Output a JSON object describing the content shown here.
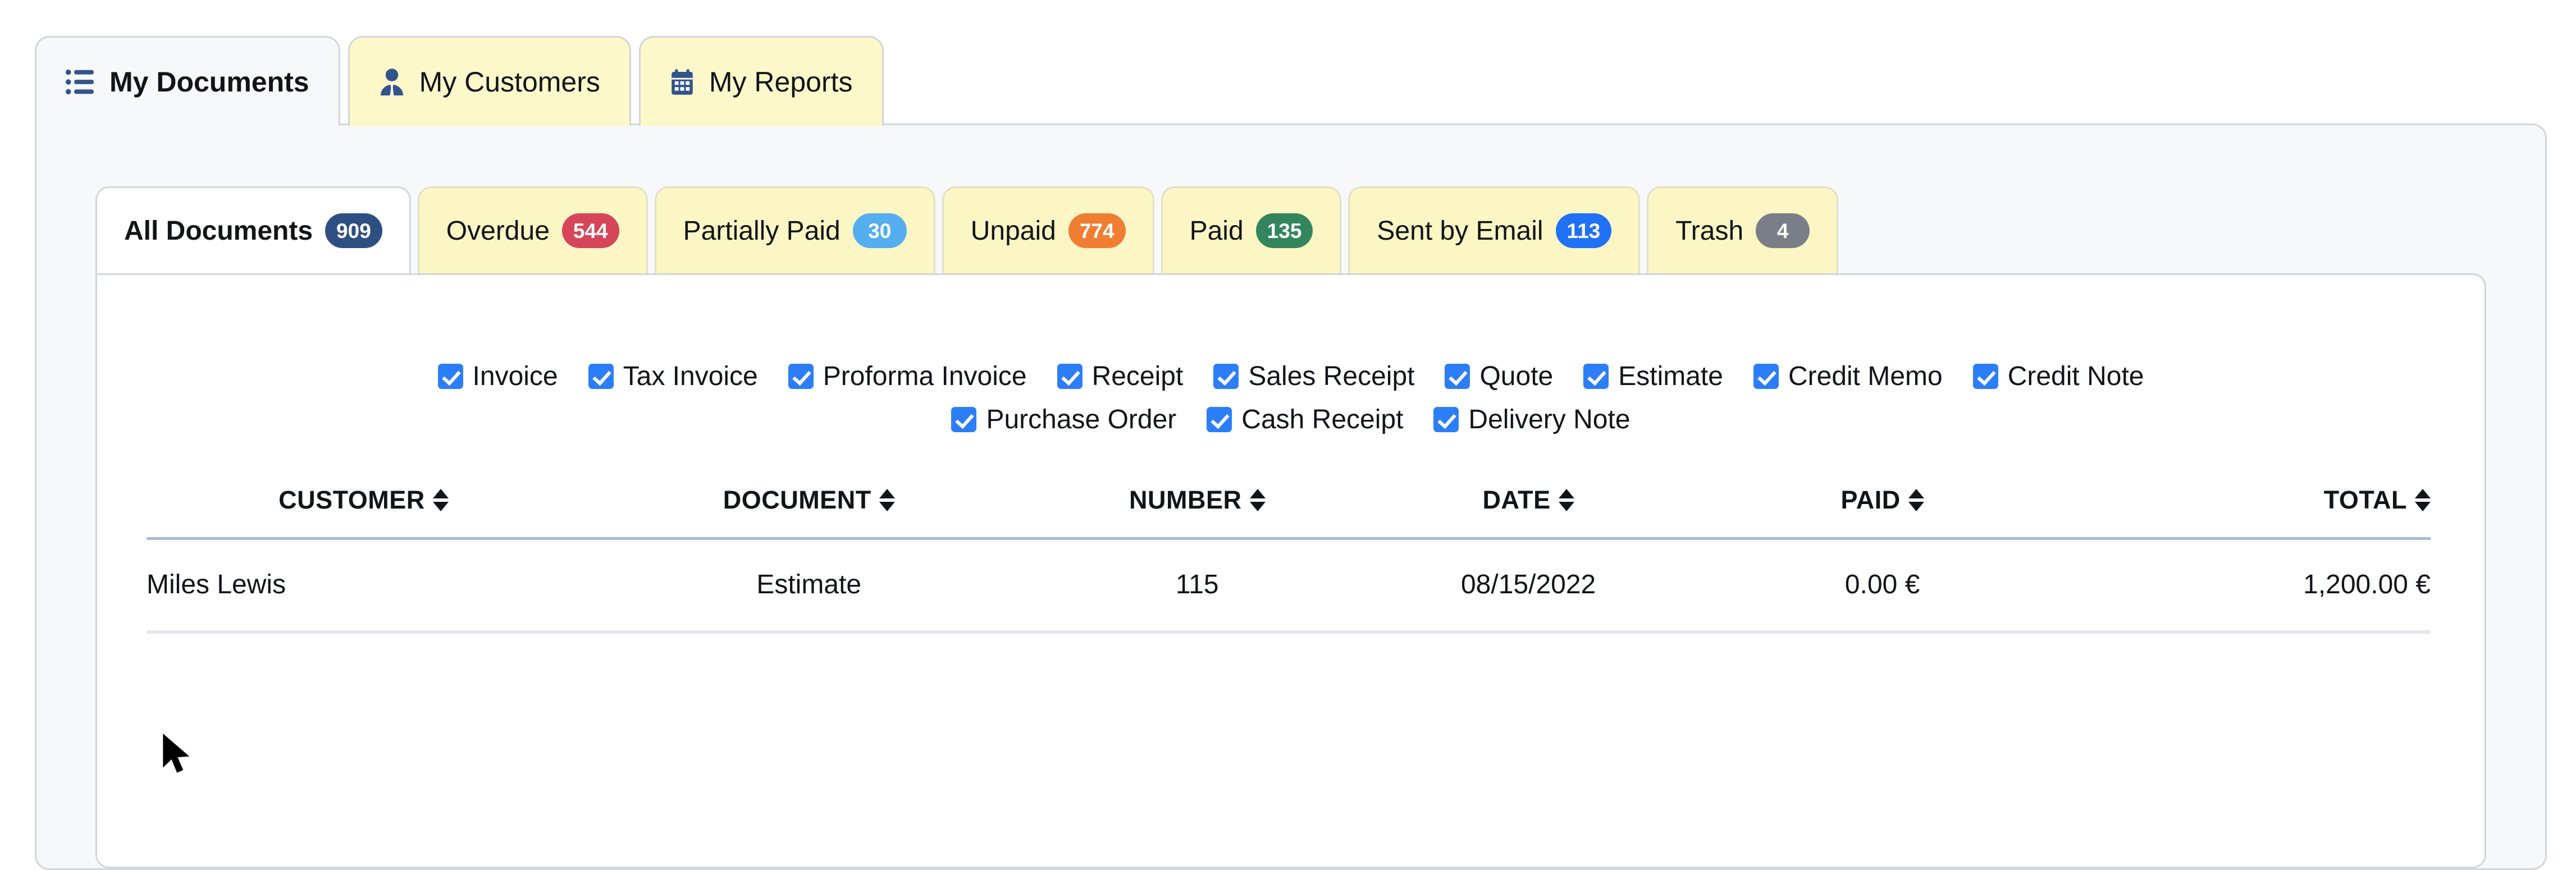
{
  "top_tabs": [
    {
      "label": "My Documents",
      "icon": "list-icon",
      "active": true
    },
    {
      "label": "My Customers",
      "icon": "user-icon",
      "active": false
    },
    {
      "label": "My Reports",
      "icon": "calendar-icon",
      "active": false
    }
  ],
  "sub_tabs": [
    {
      "label": "All Documents",
      "count": "909",
      "color": "#2e4f82",
      "active": true
    },
    {
      "label": "Overdue",
      "count": "544",
      "color": "#d6455a",
      "active": false
    },
    {
      "label": "Partially Paid",
      "count": "30",
      "color": "#54aef0",
      "active": false
    },
    {
      "label": "Unpaid",
      "count": "774",
      "color": "#ef7e32",
      "active": false
    },
    {
      "label": "Paid",
      "count": "135",
      "color": "#33855d",
      "active": false
    },
    {
      "label": "Sent by Email",
      "count": "113",
      "color": "#2071f5",
      "active": false
    },
    {
      "label": "Trash",
      "count": "4",
      "color": "#7a7f87",
      "active": false
    }
  ],
  "filters": {
    "row1": [
      {
        "label": "Invoice",
        "checked": true
      },
      {
        "label": "Tax Invoice",
        "checked": true
      },
      {
        "label": "Proforma Invoice",
        "checked": true
      },
      {
        "label": "Receipt",
        "checked": true
      },
      {
        "label": "Sales Receipt",
        "checked": true
      },
      {
        "label": "Quote",
        "checked": true
      },
      {
        "label": "Estimate",
        "checked": true
      },
      {
        "label": "Credit Memo",
        "checked": true
      },
      {
        "label": "Credit Note",
        "checked": true
      }
    ],
    "row2": [
      {
        "label": "Purchase Order",
        "checked": true
      },
      {
        "label": "Cash Receipt",
        "checked": true
      },
      {
        "label": "Delivery Note",
        "checked": true
      }
    ]
  },
  "table": {
    "columns": [
      {
        "label": "CUSTOMER",
        "sortable": true
      },
      {
        "label": "DOCUMENT",
        "sortable": true
      },
      {
        "label": "NUMBER",
        "sortable": true
      },
      {
        "label": "DATE",
        "sortable": true
      },
      {
        "label": "PAID",
        "sortable": true
      },
      {
        "label": "TOTAL",
        "sortable": true
      }
    ],
    "rows": [
      {
        "customer": "Miles Lewis",
        "document": "Estimate",
        "number": "115",
        "date": "08/15/2022",
        "paid": "0.00 €",
        "total": "1,200.00 €"
      }
    ]
  },
  "colors": {
    "accent_blue": "#2c7ef8",
    "icon_navy": "#33538c",
    "paid_orange": "#f08428",
    "tab_yellow": "#fbf6c4",
    "panel_grey": "#f6f8fa"
  },
  "cursor": {
    "type": "arrow-pointer"
  }
}
